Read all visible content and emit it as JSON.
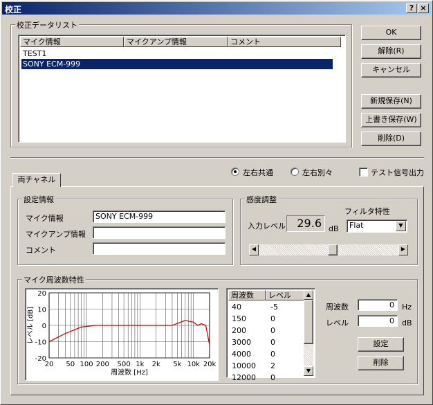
{
  "window": {
    "title": "校正",
    "help_glyph": "?",
    "close_glyph": "×"
  },
  "datalist": {
    "group_label": "校正データリスト",
    "columns": [
      "マイク情報",
      "マイクアンプ情報",
      "コメント"
    ],
    "rows": [
      {
        "mic": "TEST1",
        "selected": false
      },
      {
        "mic": "SONY ECM-999",
        "selected": true
      }
    ]
  },
  "buttons": {
    "ok": "OK",
    "release": "解除(R)",
    "cancel": "キャンセル",
    "save_new": "新規保存(N)",
    "overwrite": "上書き保存(W)",
    "delete": "削除(D)"
  },
  "mode": {
    "common_label": "左右共通",
    "separate_label": "左右別々",
    "common_selected": true,
    "test_signal_label": "テスト信号出力",
    "test_signal_checked": false
  },
  "tab": {
    "label": "両チャネル"
  },
  "settings": {
    "group_label": "設定情報",
    "mic_label": "マイク情報",
    "mic_value": "SONY ECM-999",
    "amp_label": "マイクアンプ情報",
    "amp_value": "",
    "comment_label": "コメント",
    "comment_value": ""
  },
  "sensitivity": {
    "group_label": "感度調整",
    "input_level_label": "入力レベル",
    "input_level_value": "29.6",
    "unit": "dB",
    "filter_label": "フィルタ特性",
    "filter_value": "Flat"
  },
  "response": {
    "group_label": "マイク周波数特性",
    "table_headers": [
      "周波数",
      "レベル"
    ],
    "table_rows": [
      {
        "freq": "40",
        "level": "-5"
      },
      {
        "freq": "150",
        "level": "0"
      },
      {
        "freq": "200",
        "level": "0"
      },
      {
        "freq": "3000",
        "level": "0"
      },
      {
        "freq": "4000",
        "level": "0"
      },
      {
        "freq": "10000",
        "level": "2"
      },
      {
        "freq": "12000",
        "level": "0"
      }
    ],
    "freq_label": "周波数",
    "freq_value": "0",
    "freq_unit": "Hz",
    "level_label": "レベル",
    "level_value": "0",
    "level_unit": "dB",
    "set_button": "設定",
    "delete_button": "削除"
  },
  "chart_data": {
    "type": "line",
    "xlabel": "周波数 [Hz]",
    "ylabel": "レベル [dB]",
    "x_scale": "log",
    "xlim": [
      20,
      20000
    ],
    "ylim": [
      -20,
      20
    ],
    "x_tick_labels": [
      "20",
      "50",
      "100",
      "200",
      "500",
      "1k",
      "2k",
      "5k",
      "10k",
      "20k"
    ],
    "x_tick_values": [
      20,
      50,
      100,
      200,
      500,
      1000,
      2000,
      5000,
      10000,
      20000
    ],
    "y_tick_labels": [
      "20",
      "10",
      "0",
      "-10",
      "-20"
    ],
    "y_tick_values": [
      20,
      10,
      0,
      -10,
      -20
    ],
    "grid": true,
    "line_color": "#d40000",
    "points": [
      {
        "x": 20,
        "y": -10
      },
      {
        "x": 40,
        "y": -5
      },
      {
        "x": 80,
        "y": -1
      },
      {
        "x": 150,
        "y": 0
      },
      {
        "x": 200,
        "y": 0
      },
      {
        "x": 1000,
        "y": 0
      },
      {
        "x": 3000,
        "y": 0
      },
      {
        "x": 4000,
        "y": 0
      },
      {
        "x": 7000,
        "y": 3
      },
      {
        "x": 10000,
        "y": 2
      },
      {
        "x": 12000,
        "y": 0
      },
      {
        "x": 14000,
        "y": 1
      },
      {
        "x": 17000,
        "y": 0
      },
      {
        "x": 20000,
        "y": -12
      }
    ]
  }
}
